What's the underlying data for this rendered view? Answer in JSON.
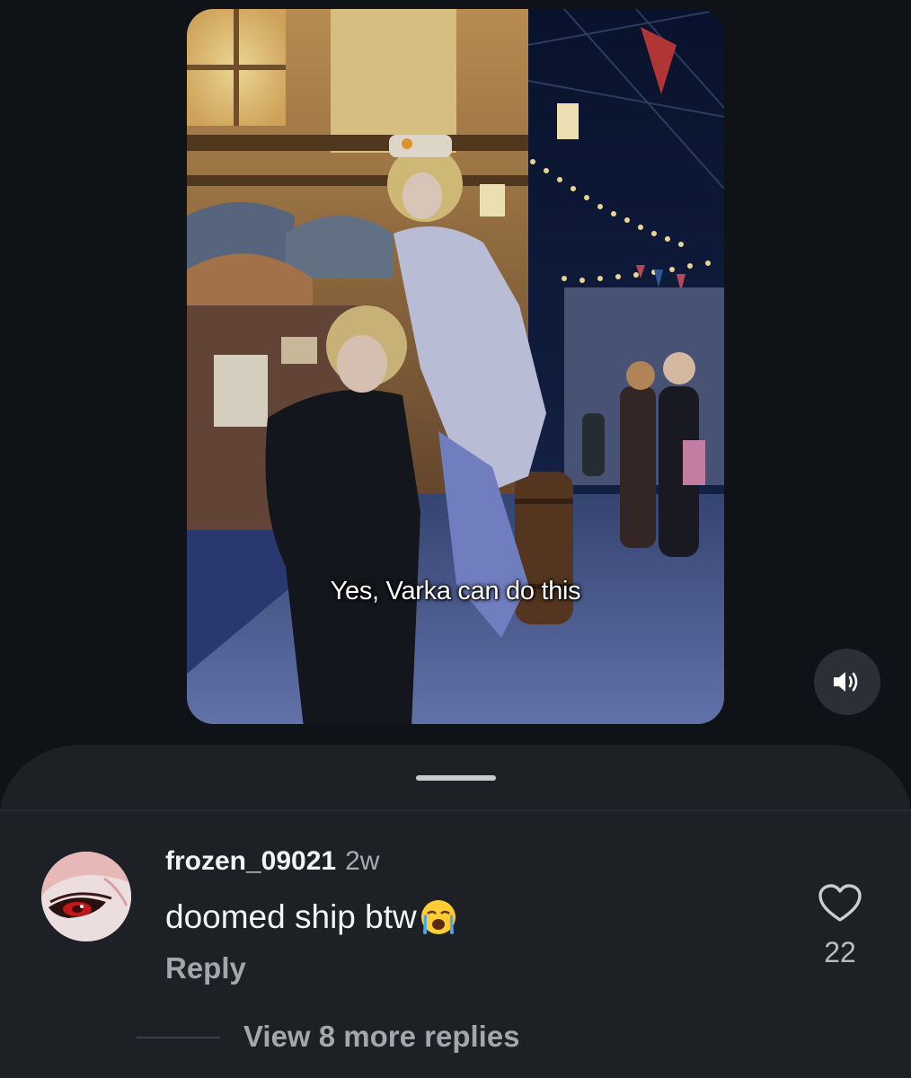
{
  "video": {
    "caption": "Yes, Varka can do this",
    "mute_icon": "speaker-volume-icon"
  },
  "comments_sheet": {
    "handle_icon": "drag-handle",
    "comment": {
      "avatar_icon": "user-avatar",
      "username": "frozen_09021",
      "timestamp": "2w",
      "text": "doomed ship btw",
      "emoji": "loudly-crying-face-emoji",
      "reply_label": "Reply",
      "like_icon": "heart-outline-icon",
      "like_count": "22"
    },
    "view_more_replies": "View 8 more replies"
  },
  "colors": {
    "background": "#0f1318",
    "sheet": "#1d2126",
    "primary_text": "#f2f3f4",
    "secondary_text": "#a3a7ac"
  }
}
